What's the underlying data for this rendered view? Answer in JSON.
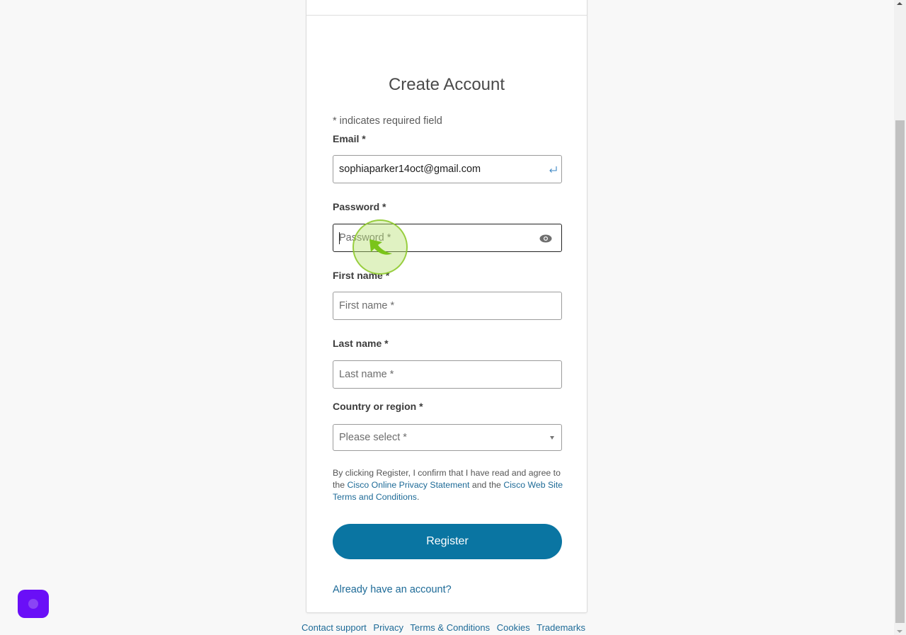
{
  "page": {
    "title": "Create Account",
    "required_note": "* indicates required field"
  },
  "form": {
    "email": {
      "label": "Email *",
      "value": "sophiaparker14oct@gmail.com",
      "icon": "enter-icon"
    },
    "password": {
      "label": "Password *",
      "placeholder": "Password *",
      "value": "",
      "icon": "eye-icon",
      "focused": true
    },
    "first_name": {
      "label": "First name *",
      "placeholder": "First name *",
      "value": ""
    },
    "last_name": {
      "label": "Last name *",
      "placeholder": "Last name *",
      "value": ""
    },
    "country": {
      "label": "Country or region *",
      "selected": "Please select *"
    }
  },
  "consent": {
    "prefix": "By clicking Register, I confirm that I have read and agree to the ",
    "privacy_link": "Cisco Online Privacy Statement",
    "middle": " and the ",
    "terms_link": "Cisco Web Site Terms and Conditions",
    "suffix": "."
  },
  "actions": {
    "register_label": "Register",
    "signin_link": "Already have an account?"
  },
  "footer": {
    "links": [
      "Contact support",
      "Privacy",
      "Terms & Conditions",
      "Cookies",
      "Trademarks"
    ]
  },
  "colors": {
    "primary": "#0a75a2",
    "link": "#1d6a97",
    "chat_launcher": "#6a0ff7",
    "click_indicator": "#8cc828"
  }
}
